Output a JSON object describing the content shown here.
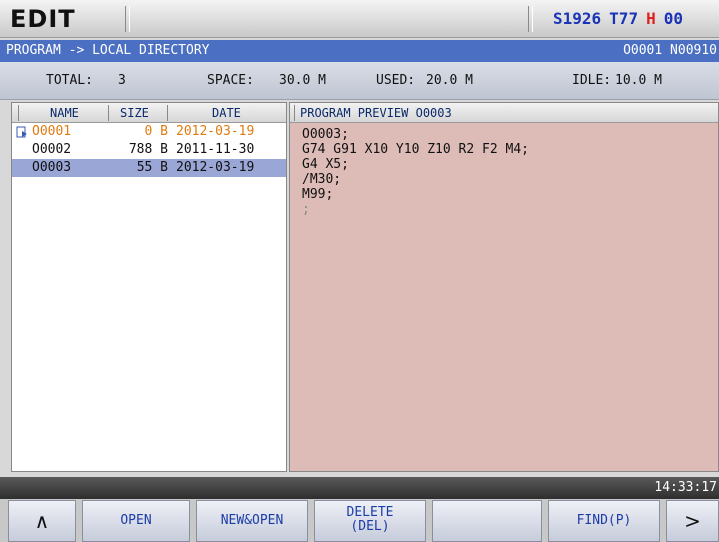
{
  "header": {
    "mode": "EDIT",
    "spindle": "S1926",
    "tool": "T77",
    "h_prefix": "H",
    "h_value": "00"
  },
  "path": {
    "location": "PROGRAM -> LOCAL DIRECTORY",
    "current": "O0001 N00910"
  },
  "info": {
    "total_label": "TOTAL:",
    "total_value": "3",
    "space_label": "SPACE:",
    "space_value": "30.0 M",
    "used_label": "USED:",
    "used_value": "20.0 M",
    "idle_label": "IDLE:",
    "idle_value": "10.0 M"
  },
  "file_list": {
    "columns": [
      "NAME",
      "SIZE",
      "DATE"
    ],
    "rows": [
      {
        "name": "O0001",
        "size": "0 B",
        "date": "2012-03-19"
      },
      {
        "name": "O0002",
        "size": "788 B",
        "date": "2011-11-30"
      },
      {
        "name": "O0003",
        "size": "55 B",
        "date": "2012-03-19"
      }
    ]
  },
  "preview": {
    "title": "PROGRAM PREVIEW O0003",
    "lines": [
      "O0003;",
      "G74 G91 X10 Y10 Z10 R2 F2 M4;",
      "G4 X5;",
      "/M30;",
      "M99;",
      ";"
    ]
  },
  "clock": "14:33:17",
  "softkeys": {
    "up": "∧",
    "open": "OPEN",
    "new_open": "NEW&OPEN",
    "delete_1": "DELETE",
    "delete_2": "(DEL)",
    "blank": "",
    "find": "FIND(P)",
    "next": ">"
  },
  "colors": {
    "path_bar": "#4b6fc2",
    "preview_bg": "#ddbcb8",
    "selected_row": "#9aa6d6",
    "current_row_text": "#e07a10"
  }
}
